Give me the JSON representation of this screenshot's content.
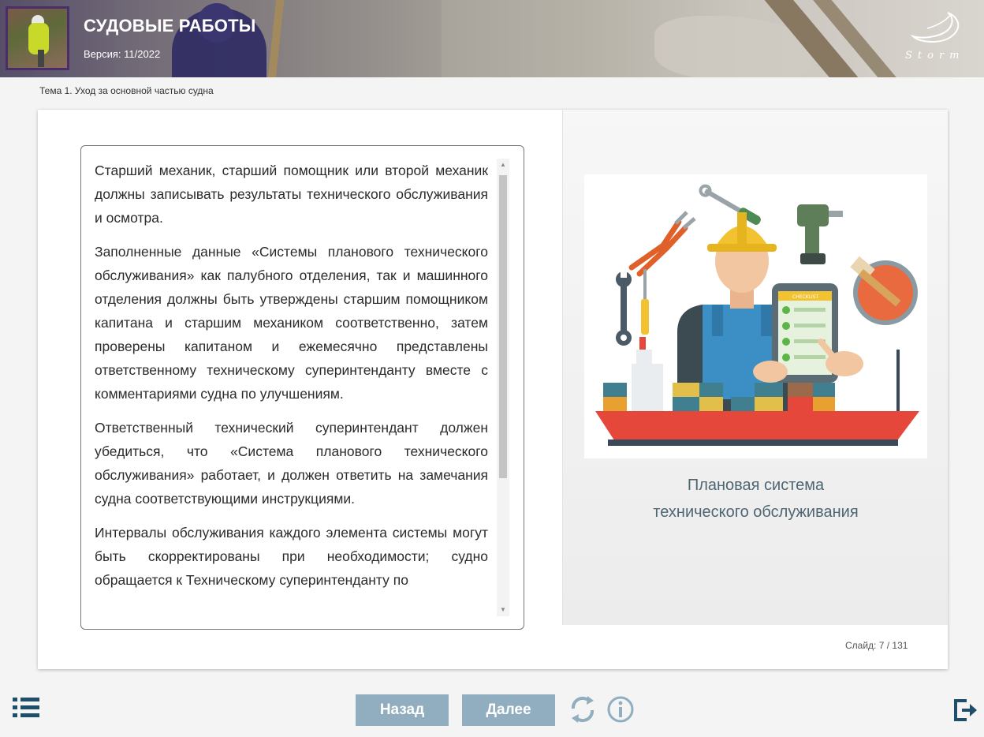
{
  "header": {
    "title": "СУДОВЫЕ РАБОТЫ",
    "version": "Версия: 11/2022",
    "logo_text": "Storm"
  },
  "breadcrumb": "Тема 1. Уход за основной частью судна",
  "slide": {
    "paragraphs": [
      "Старший механик, старший помощник или второй механик должны записывать результаты технического обслуживания и осмотра.",
      "Заполненные данные «Системы планового технического обслуживания» как палубного отделения, так и машинного отделения должны быть утверждены старшим помощником капитана и старшим механиком соответственно, затем проверены капитаном и ежемесячно представлены ответственному техническому суперинтенданту вместе с комментариями судна по улучшениям.",
      "Ответственный технический суперинтендант должен убедиться, что «Система планового технического обслуживания» работает, и должен ответить на замечания судна соответствующими инструкциями.",
      "Интервалы обслуживания каждого элемента системы могут быть скорректированы при необходимости; судно обращается к Техническому суперинтенданту по"
    ],
    "caption_line1": "Плановая система",
    "caption_line2": "технического обслуживания",
    "checklist_label": "CHECKLIST",
    "counter_label": "Слайд:",
    "counter_value": "7 / 131"
  },
  "nav": {
    "back_label": "Назад",
    "next_label": "Далее"
  },
  "icons": {
    "menu": "list-menu-icon",
    "reload": "reload-icon",
    "info": "info-icon",
    "exit": "exit-icon"
  },
  "colors": {
    "accent": "#90aebf",
    "icon": "#1f4e6b",
    "caption": "#4d6672"
  }
}
